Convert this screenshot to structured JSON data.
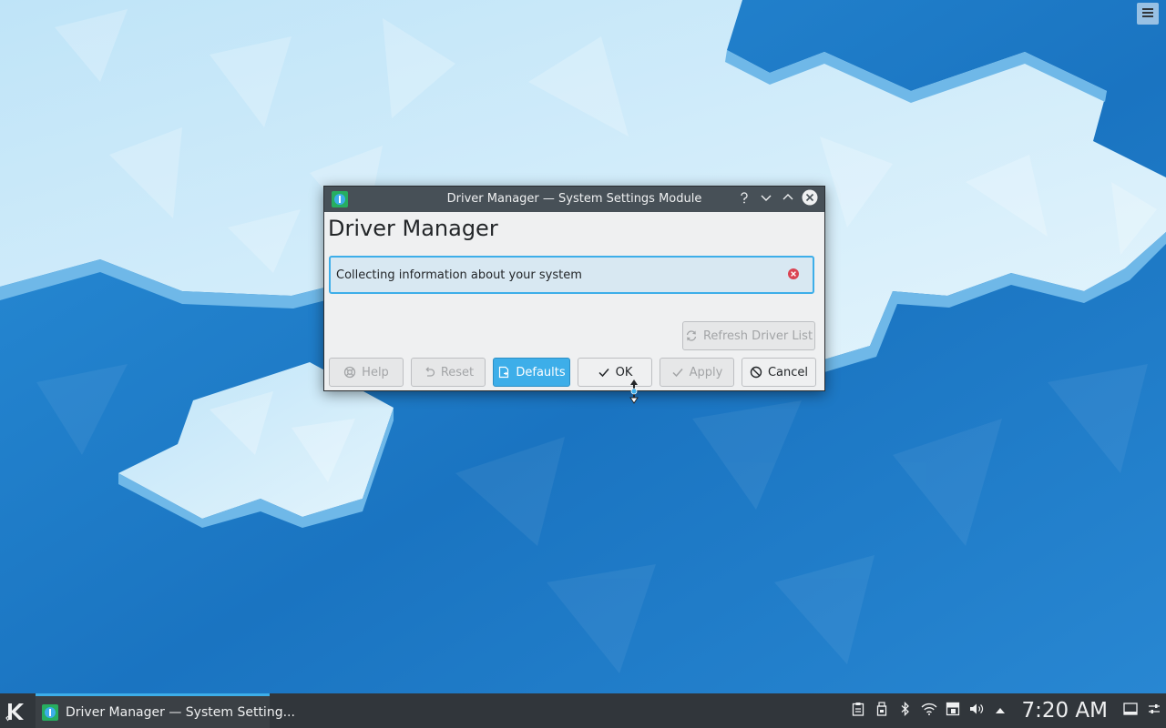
{
  "dialog": {
    "window_title": "Driver Manager — System Settings Module",
    "heading": "Driver Manager",
    "message": "Collecting information about your system",
    "refresh_label": "Refresh Driver List",
    "buttons": {
      "help": "Help",
      "reset": "Reset",
      "defaults": "Defaults",
      "ok": "OK",
      "apply": "Apply",
      "cancel": "Cancel"
    }
  },
  "taskbar": {
    "task_label": "Driver Manager — System Setting...",
    "clock": "7:20 AM"
  },
  "colors": {
    "accent": "#3daee9",
    "titlebar": "#475057",
    "taskbar": "#31363b",
    "desktop": "#1d79c4"
  }
}
